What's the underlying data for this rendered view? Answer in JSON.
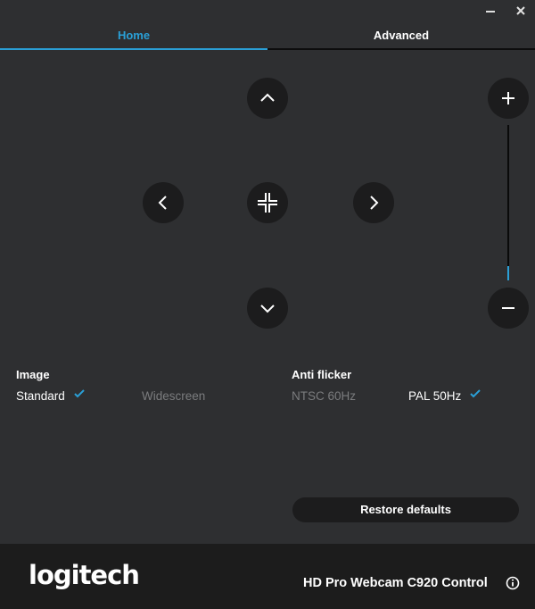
{
  "window": {
    "controls": [
      {
        "name": "minimize",
        "icon": "minimize-icon"
      },
      {
        "name": "close",
        "icon": "close-icon"
      }
    ]
  },
  "tabs": [
    {
      "label": "Home",
      "active": true
    },
    {
      "label": "Advanced",
      "active": false
    }
  ],
  "pan_controls": {
    "up_icon": "chevron-up-icon",
    "left_icon": "chevron-left-icon",
    "center_icon": "recenter-icon",
    "right_icon": "chevron-right-icon",
    "down_icon": "chevron-down-icon"
  },
  "zoom": {
    "in_icon": "plus-icon",
    "out_icon": "minus-icon",
    "level_fraction": 0.09
  },
  "image": {
    "label": "Image",
    "options": [
      {
        "label": "Standard",
        "selected": true
      },
      {
        "label": "Widescreen",
        "selected": false
      }
    ]
  },
  "anti_flicker": {
    "label": "Anti flicker",
    "options": [
      {
        "label": "NTSC 60Hz",
        "selected": false
      },
      {
        "label": "PAL 50Hz",
        "selected": true
      }
    ]
  },
  "restore_defaults_label": "Restore defaults",
  "footer": {
    "logo_text": "logitech",
    "product_name": "HD Pro Webcam C920 Control",
    "info_icon": "info-icon"
  },
  "colors": {
    "accent": "#2a9fd6",
    "background": "#2e2f31",
    "footer_background": "#1c1c1c",
    "button_background": "#1c1c1d",
    "unselected_text": "#7b7c7e"
  }
}
